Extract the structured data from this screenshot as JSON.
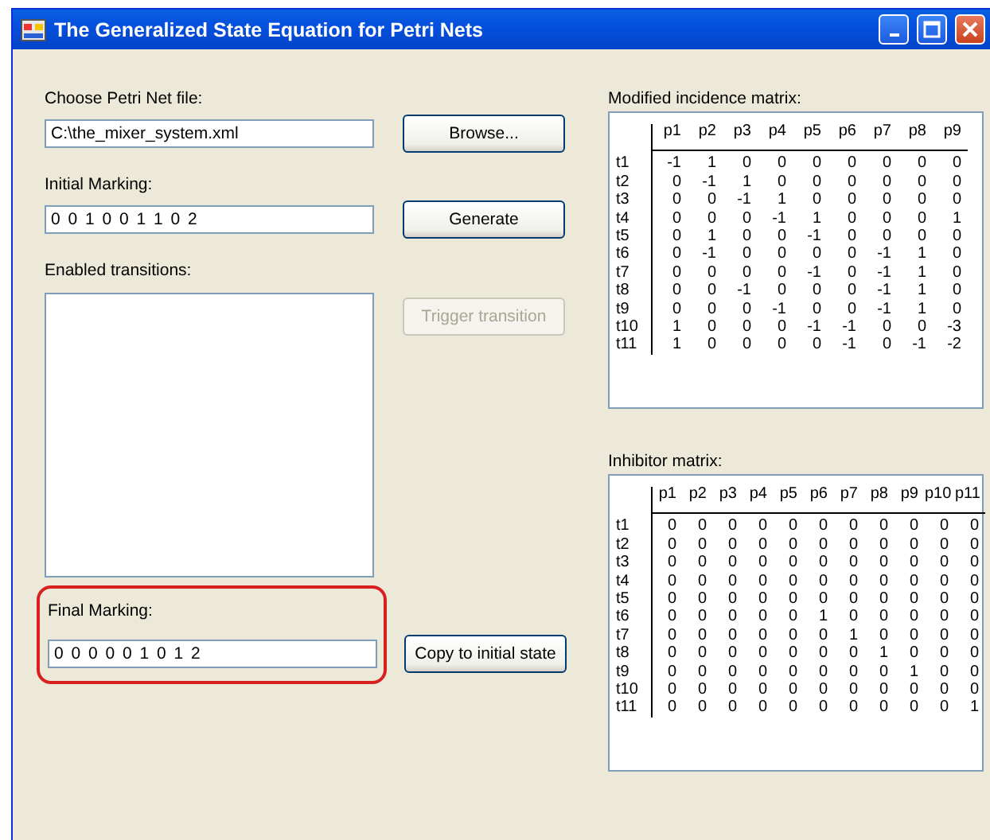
{
  "window": {
    "title": "The Generalized State Equation for Petri Nets"
  },
  "file": {
    "label": "Choose Petri Net file:",
    "value": "C:\\the_mixer_system.xml",
    "button": {
      "label": "Browse...",
      "disabled": false
    }
  },
  "initial_marking": {
    "label": "Initial Marking:",
    "value": "0 0 1 0 0 1 1 0 2",
    "button": {
      "label": "Generate",
      "disabled": false
    }
  },
  "enabled_transitions": {
    "label": "Enabled transitions:",
    "button": {
      "label": "Trigger transition",
      "disabled": true
    }
  },
  "final_marking": {
    "label": "Final Marking:",
    "value": "0 0 0 0 0 1 0 1 2",
    "highlighted": true,
    "button": {
      "label": "Copy to initial state",
      "disabled": false
    }
  },
  "matrices": [
    {
      "label": "Modified incidence matrix:",
      "columns": [
        "p1",
        "p2",
        "p3",
        "p4",
        "p5",
        "p6",
        "p7",
        "p8",
        "p9"
      ],
      "rows": [
        {
          "name": "t1",
          "values": [
            "-1",
            "1",
            "0",
            "0",
            "0",
            "0",
            "0",
            "0",
            "0"
          ]
        },
        {
          "name": "t2",
          "values": [
            "0",
            "-1",
            "1",
            "0",
            "0",
            "0",
            "0",
            "0",
            "0"
          ]
        },
        {
          "name": "t3",
          "values": [
            "0",
            "0",
            "-1",
            "1",
            "0",
            "0",
            "0",
            "0",
            "0"
          ]
        },
        {
          "name": "t4",
          "values": [
            "0",
            "0",
            "0",
            "-1",
            "1",
            "0",
            "0",
            "0",
            "1"
          ]
        },
        {
          "name": "t5",
          "values": [
            "0",
            "1",
            "0",
            "0",
            "-1",
            "0",
            "0",
            "0",
            "0"
          ]
        },
        {
          "name": "t6",
          "values": [
            "0",
            "-1",
            "0",
            "0",
            "0",
            "0",
            "-1",
            "1",
            "0"
          ]
        },
        {
          "name": "t7",
          "values": [
            "0",
            "0",
            "0",
            "0",
            "-1",
            "0",
            "-1",
            "1",
            "0"
          ]
        },
        {
          "name": "t8",
          "values": [
            "0",
            "0",
            "-1",
            "0",
            "0",
            "0",
            "-1",
            "1",
            "0"
          ]
        },
        {
          "name": "t9",
          "values": [
            "0",
            "0",
            "0",
            "-1",
            "0",
            "0",
            "-1",
            "1",
            "0"
          ]
        },
        {
          "name": "t10",
          "values": [
            "1",
            "0",
            "0",
            "0",
            "-1",
            "-1",
            "0",
            "0",
            "-3"
          ]
        },
        {
          "name": "t11",
          "values": [
            "1",
            "0",
            "0",
            "0",
            "0",
            "-1",
            "0",
            "-1",
            "-2"
          ]
        }
      ]
    },
    {
      "label": "Inhibitor matrix:",
      "columns": [
        "p1",
        "p2",
        "p3",
        "p4",
        "p5",
        "p6",
        "p7",
        "p8",
        "p9",
        "p10",
        "p11"
      ],
      "rows": [
        {
          "name": "t1",
          "values": [
            "0",
            "0",
            "0",
            "0",
            "0",
            "0",
            "0",
            "0",
            "0",
            "0",
            "0"
          ]
        },
        {
          "name": "t2",
          "values": [
            "0",
            "0",
            "0",
            "0",
            "0",
            "0",
            "0",
            "0",
            "0",
            "0",
            "0"
          ]
        },
        {
          "name": "t3",
          "values": [
            "0",
            "0",
            "0",
            "0",
            "0",
            "0",
            "0",
            "0",
            "0",
            "0",
            "0"
          ]
        },
        {
          "name": "t4",
          "values": [
            "0",
            "0",
            "0",
            "0",
            "0",
            "0",
            "0",
            "0",
            "0",
            "0",
            "0"
          ]
        },
        {
          "name": "t5",
          "values": [
            "0",
            "0",
            "0",
            "0",
            "0",
            "0",
            "0",
            "0",
            "0",
            "0",
            "0"
          ]
        },
        {
          "name": "t6",
          "values": [
            "0",
            "0",
            "0",
            "0",
            "0",
            "1",
            "0",
            "0",
            "0",
            "0",
            "0"
          ]
        },
        {
          "name": "t7",
          "values": [
            "0",
            "0",
            "0",
            "0",
            "0",
            "0",
            "1",
            "0",
            "0",
            "0",
            "0"
          ]
        },
        {
          "name": "t8",
          "values": [
            "0",
            "0",
            "0",
            "0",
            "0",
            "0",
            "0",
            "1",
            "0",
            "0",
            "0"
          ]
        },
        {
          "name": "t9",
          "values": [
            "0",
            "0",
            "0",
            "0",
            "0",
            "0",
            "0",
            "0",
            "1",
            "0",
            "0"
          ]
        },
        {
          "name": "t10",
          "values": [
            "0",
            "0",
            "0",
            "0",
            "0",
            "0",
            "0",
            "0",
            "0",
            "0",
            "0"
          ]
        },
        {
          "name": "t11",
          "values": [
            "0",
            "0",
            "0",
            "0",
            "0",
            "0",
            "0",
            "0",
            "0",
            "0",
            "1"
          ]
        }
      ]
    }
  ]
}
